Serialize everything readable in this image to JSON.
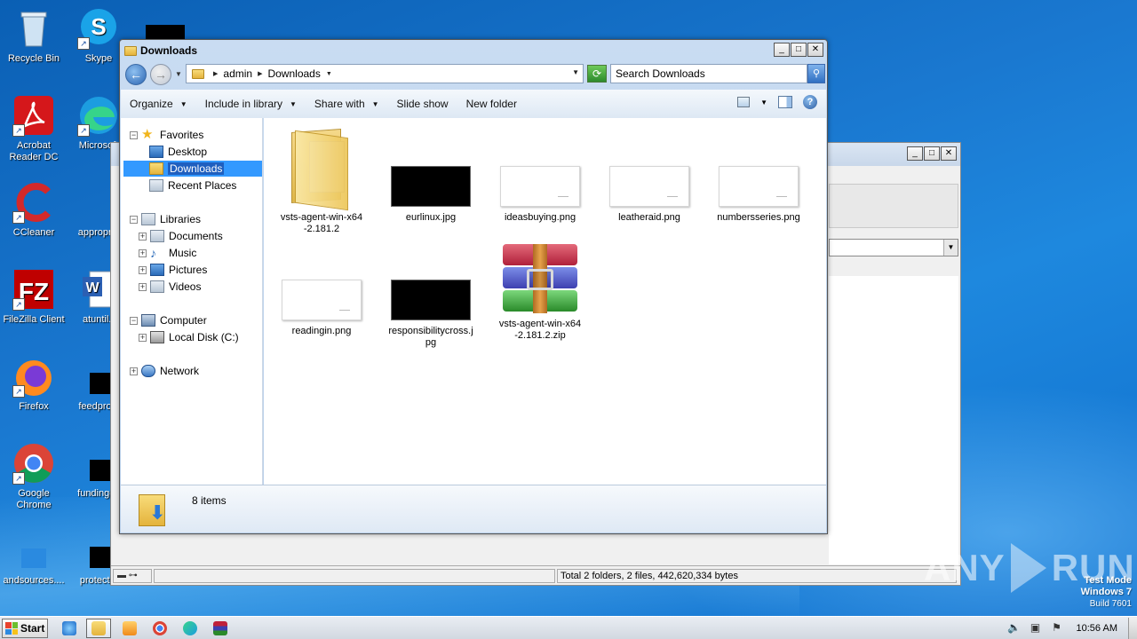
{
  "desktop": {
    "icons": [
      {
        "label": "Recycle Bin"
      },
      {
        "label": "Skype"
      },
      {
        "label": "Acrobat Reader DC"
      },
      {
        "label": "Microsoft"
      },
      {
        "label": "CCleaner"
      },
      {
        "label": "appropria"
      },
      {
        "label": "FileZilla Client"
      },
      {
        "label": "atuntil.r"
      },
      {
        "label": "Firefox"
      },
      {
        "label": "feedprovi"
      },
      {
        "label": "Google Chrome"
      },
      {
        "label": "fundingch"
      },
      {
        "label": "andsources...."
      },
      {
        "label": "protectio"
      }
    ]
  },
  "background_window": {
    "status_total": "Total 2 folders, 2 files, 442,620,334 bytes"
  },
  "explorer": {
    "title": "Downloads",
    "breadcrumb": [
      "admin",
      "Downloads"
    ],
    "search_placeholder": "Search Downloads",
    "toolbar": {
      "organize": "Organize",
      "include_in_library": "Include in library",
      "share_with": "Share with",
      "slide_show": "Slide show",
      "new_folder": "New folder"
    },
    "nav": {
      "favorites": "Favorites",
      "desktop": "Desktop",
      "downloads": "Downloads",
      "recent_places": "Recent Places",
      "libraries": "Libraries",
      "documents": "Documents",
      "music": "Music",
      "pictures": "Pictures",
      "videos": "Videos",
      "computer": "Computer",
      "local_disk": "Local Disk (C:)",
      "network": "Network"
    },
    "files": [
      {
        "name": "vsts-agent-win-x64-2.181.2",
        "line1": "vsts-agent-win-x64",
        "line2": "-2.181.2",
        "kind": "folder"
      },
      {
        "name": "eurlinux.jpg",
        "line1": "eurlinux.jpg",
        "line2": "",
        "kind": "black-image"
      },
      {
        "name": "ideasbuying.png",
        "line1": "ideasbuying.png",
        "line2": "",
        "kind": "white-image"
      },
      {
        "name": "leatheraid.png",
        "line1": "leatheraid.png",
        "line2": "",
        "kind": "white-image"
      },
      {
        "name": "numbersseries.png",
        "line1": "numbersseries.png",
        "line2": "",
        "kind": "white-image"
      },
      {
        "name": "readingin.png",
        "line1": "readingin.png",
        "line2": "",
        "kind": "white-image"
      },
      {
        "name": "responsibilitycross.jpg",
        "line1": "responsibilitycross.j",
        "line2": "pg",
        "kind": "black-image"
      },
      {
        "name": "vsts-agent-win-x64-2.181.2.zip",
        "line1": "vsts-agent-win-x64",
        "line2": "-2.181.2.zip",
        "kind": "rar-archive"
      }
    ],
    "details": {
      "item_count": "8 items"
    }
  },
  "watermark": {
    "text_left": "ANY",
    "text_right": "RUN"
  },
  "test_mode": {
    "line1": "Test Mode",
    "line2": "Windows 7",
    "line3": "Build 7601"
  },
  "taskbar": {
    "start_label": "Start",
    "clock": "10:56 AM"
  }
}
